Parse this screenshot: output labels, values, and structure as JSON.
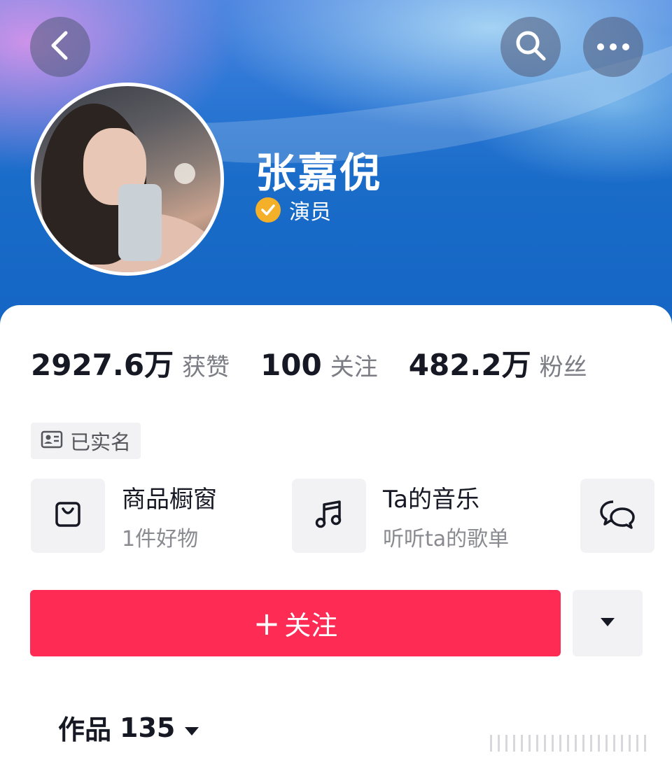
{
  "header": {
    "back_icon": "chevron-left-icon",
    "search_icon": "search-icon",
    "more_icon": "more-horizontal-icon"
  },
  "profile": {
    "name": "张嘉倪",
    "verified_label": "演员",
    "verified_color": "#f5b02a"
  },
  "stats": [
    {
      "value": "2927.6万",
      "label": "获赞"
    },
    {
      "value": "100",
      "label": "关注"
    },
    {
      "value": "482.2万",
      "label": "粉丝"
    }
  ],
  "realname_tag": "已实名",
  "features": {
    "shop": {
      "title": "商品橱窗",
      "subtitle": "1件好物",
      "icon": "shopping-bag-icon"
    },
    "music": {
      "title": "Ta的音乐",
      "subtitle": "听听ta的歌单",
      "icon": "music-note-icon"
    },
    "chat": {
      "icon": "chat-bubbles-icon"
    }
  },
  "actions": {
    "follow_plus": "+",
    "follow_label": "关注",
    "follow_color": "#fe2c55"
  },
  "tabs": {
    "works_label": "作品",
    "works_count": "135"
  }
}
